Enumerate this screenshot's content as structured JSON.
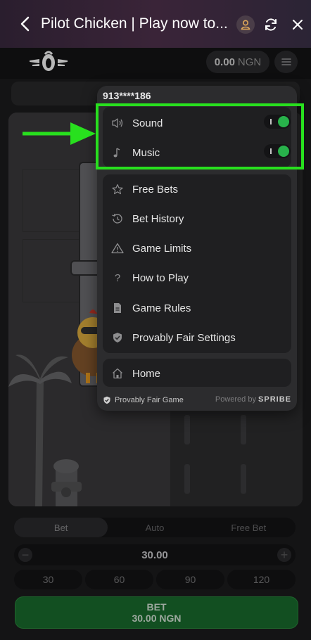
{
  "browser": {
    "title": "Pilot Chicken | Play now to...",
    "back_icon": "chevron-left-icon",
    "user_icon": "user-icon",
    "reload_icon": "reload-icon",
    "close_icon": "close-icon"
  },
  "header": {
    "balance_value": "0.00",
    "balance_currency": "NGN",
    "menu_icon": "hamburger-icon"
  },
  "menu": {
    "username": "913****186",
    "settings": [
      {
        "label": "Sound",
        "icon": "speaker-icon",
        "enabled": true
      },
      {
        "label": "Music",
        "icon": "music-note-icon",
        "enabled": true
      }
    ],
    "items": [
      {
        "label": "Free Bets",
        "icon": "star-icon"
      },
      {
        "label": "Bet History",
        "icon": "history-icon"
      },
      {
        "label": "Game Limits",
        "icon": "warning-icon"
      },
      {
        "label": "How to Play",
        "icon": "question-icon"
      },
      {
        "label": "Game Rules",
        "icon": "document-icon"
      },
      {
        "label": "Provably Fair Settings",
        "icon": "shield-check-icon"
      }
    ],
    "home": {
      "label": "Home",
      "icon": "home-icon"
    },
    "footer_left": "Provably Fair Game",
    "footer_powered": "Powered by",
    "footer_brand": "SPRIBE"
  },
  "bet": {
    "tabs": [
      "Bet",
      "Auto",
      "Free Bet"
    ],
    "amount": "30.00",
    "quick_amounts": [
      "30",
      "60",
      "90",
      "120"
    ],
    "button_label": "BET",
    "button_amount": "30.00 NGN"
  },
  "colors": {
    "highlight": "#28e01e",
    "toggle_on": "#28b24b",
    "bet_button": "#1a6e2e"
  }
}
